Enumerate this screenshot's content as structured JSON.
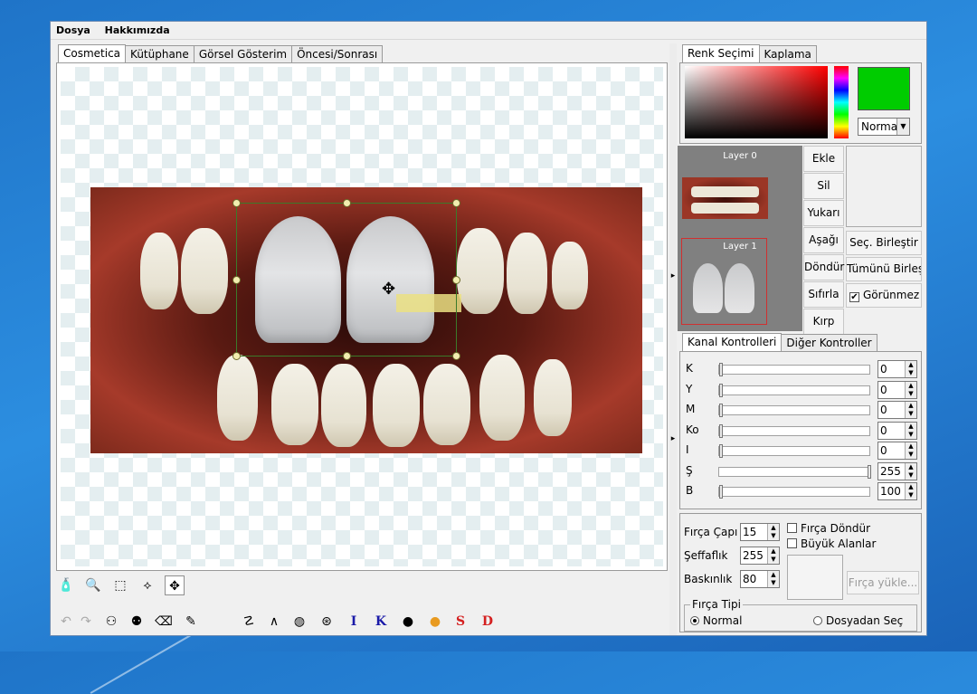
{
  "menu": [
    "Dosya",
    "Hakkımızda"
  ],
  "left_tabs": [
    "Cosmetica",
    "Kütüphane",
    "Görsel Gösterim",
    "Öncesi/Sonrası"
  ],
  "right_tabs": [
    "Renk Seçimi",
    "Kaplama"
  ],
  "color": {
    "current": "#00cc00",
    "blend_mode": "Norma"
  },
  "layers": [
    {
      "label": "Layer 0"
    },
    {
      "label": "Layer 1"
    }
  ],
  "layer_buttons": [
    "Ekle",
    "Sil",
    "Yukarı",
    "Aşağı",
    "Döndür",
    "Sıfırla",
    "Kırp"
  ],
  "merge_buttons": [
    "Seç. Birleştir",
    "Tümünü Birleş"
  ],
  "visible_checkbox": {
    "label": "Görünmez",
    "checked": true
  },
  "channel_tabs": [
    "Kanal Kontrolleri",
    "Diğer Kontroller"
  ],
  "channels": [
    {
      "label": "K",
      "value": "0",
      "level": 0
    },
    {
      "label": "Y",
      "value": "0",
      "level": 0
    },
    {
      "label": "M",
      "value": "0",
      "level": 0
    },
    {
      "label": "Ko",
      "value": "0",
      "level": 0
    },
    {
      "label": "I",
      "value": "0",
      "level": 0
    },
    {
      "label": "Ş",
      "value": "255",
      "level": 1
    },
    {
      "label": "B",
      "value": "100",
      "level": 0
    }
  ],
  "brush": {
    "size_label": "Fırça Çapı",
    "size_value": "15",
    "opacity_label": "Şeffaflık",
    "opacity_value": "255",
    "pressure_label": "Baskınlık",
    "pressure_value": "80",
    "rotate_label": "Fırça Döndür",
    "large_areas_label": "Büyük Alanlar",
    "load_label": "Fırça yükle...",
    "type_legend": "Fırça Tipi",
    "type_normal": "Normal",
    "type_file": "Dosyadan Seç"
  },
  "tool_letters": [
    "I",
    "K",
    "S",
    "D"
  ],
  "tool_letter_colors": [
    "#1a1aa8",
    "#1a1aa8",
    "#d42020",
    "#d42020"
  ]
}
